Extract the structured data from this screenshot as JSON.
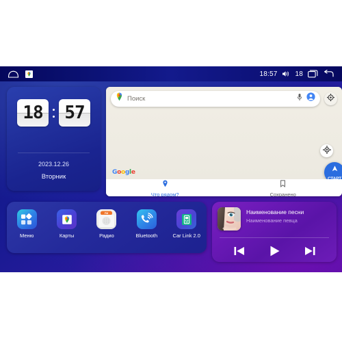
{
  "status_bar": {
    "home_icon": "home-icon",
    "app_badge_icon": "google-maps-badge-icon",
    "time": "18:57",
    "volume_icon": "volume-icon",
    "volume_level": "18",
    "recents_icon": "recents-icon",
    "back_icon": "back-icon"
  },
  "clock_widget": {
    "hours": "18",
    "minutes": "57",
    "date": "2023.12.26",
    "weekday": "Вторник"
  },
  "map_widget": {
    "pin_icon": "maps-pin-icon",
    "search_placeholder": "Поиск",
    "mic_icon": "microphone-icon",
    "avatar_icon": "account-avatar-icon",
    "settings_icon": "settings-gear-icon",
    "attribution": "Google",
    "locate_icon": "locate-compass-icon",
    "start_label": "СТАРТ",
    "start_icon": "navigation-arrow-icon",
    "tabs": [
      {
        "label": "Что рядом?",
        "icon": "location-pin-icon",
        "active": true
      },
      {
        "label": "Сохранено",
        "icon": "bookmark-icon",
        "active": false
      }
    ]
  },
  "apps_widget": {
    "apps": [
      {
        "label": "Меню",
        "icon": "apps-grid-icon"
      },
      {
        "label": "Карты",
        "icon": "google-maps-icon"
      },
      {
        "label": "Радио",
        "icon": "fm-radio-icon",
        "band": "FM"
      },
      {
        "label": "Bluetooth",
        "icon": "bluetooth-phone-icon"
      },
      {
        "label": "Car Link 2.0",
        "icon": "car-link-icon"
      }
    ]
  },
  "media_widget": {
    "album_art_icon": "album-art-portrait",
    "song_title": "Наименование песни",
    "artist_name": "Наименование певца",
    "controls": [
      {
        "name": "previous-track-button",
        "icon": "skip-previous-icon"
      },
      {
        "name": "play-button",
        "icon": "play-icon"
      },
      {
        "name": "next-track-button",
        "icon": "skip-next-icon"
      }
    ]
  },
  "colors": {
    "screen_bg_start": "#0a0f6e",
    "screen_bg_end": "#4b0fa0",
    "accent_blue": "#2b6ddf",
    "media_purple": "#6a19b6",
    "map_bg": "#efece3"
  }
}
